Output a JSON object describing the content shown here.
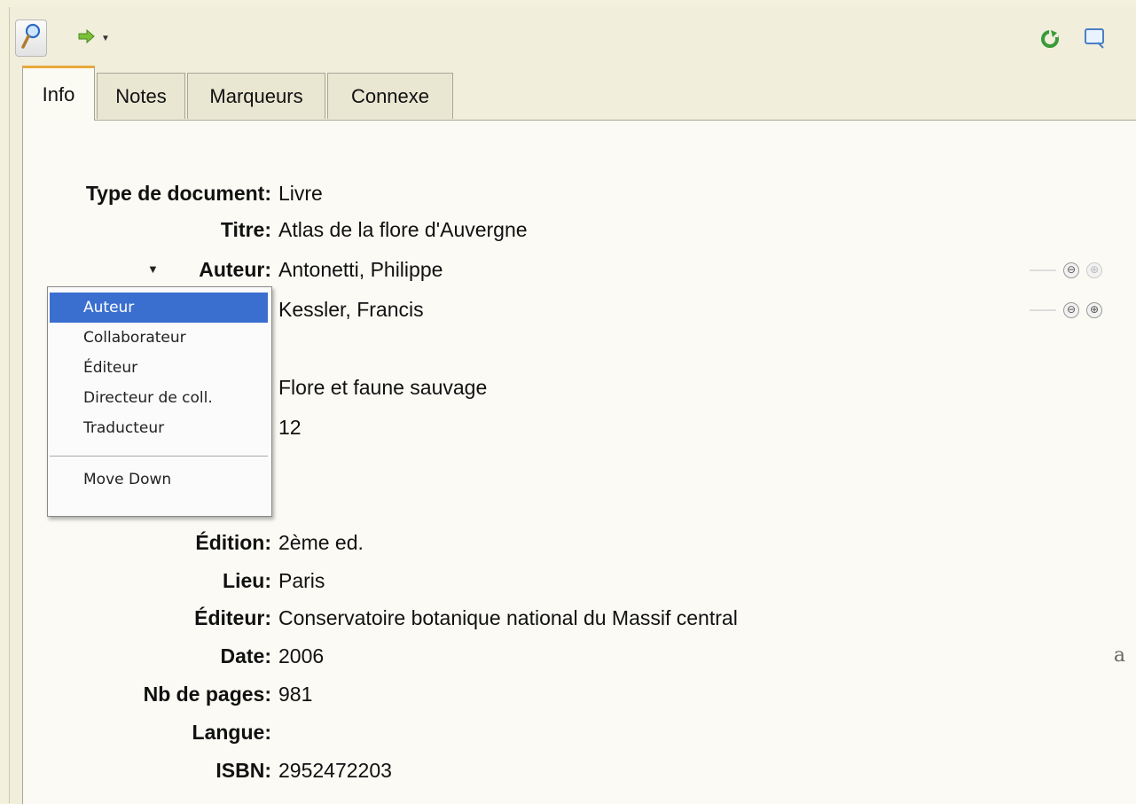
{
  "toolbar": {
    "search_icon": "magnifier-icon",
    "go_icon": "green-arrow-icon",
    "refresh_icon": "green-refresh-icon",
    "screen_icon": "screen-icon"
  },
  "tabs": [
    {
      "label": "Info",
      "active": true
    },
    {
      "label": "Notes",
      "active": false
    },
    {
      "label": "Marqueurs",
      "active": false
    },
    {
      "label": "Connexe",
      "active": false
    }
  ],
  "fields": {
    "type": {
      "label": "Type de document:",
      "value": "Livre"
    },
    "title": {
      "label": "Titre:",
      "value": "Atlas de la flore d'Auvergne"
    },
    "author1": {
      "label": "Auteur:",
      "value": "Antonetti, Philippe"
    },
    "author2": {
      "value": "Kessler, Francis"
    },
    "series": {
      "value": "Flore et faune sauvage"
    },
    "series_num": {
      "value": "12"
    },
    "edition": {
      "label": "Édition:",
      "value": "2ème ed."
    },
    "place": {
      "label": "Lieu:",
      "value": "Paris"
    },
    "publisher": {
      "label": "Éditeur:",
      "value": "Conservatoire botanique national du Massif central"
    },
    "date": {
      "label": "Date:",
      "value": "2006",
      "side": "a"
    },
    "pages": {
      "label": "Nb de pages:",
      "value": "981"
    },
    "language": {
      "label": "Langue:",
      "value": ""
    },
    "isbn": {
      "label": "ISBN:",
      "value": "2952472203"
    }
  },
  "row_buttons": {
    "minus": "⊖",
    "plus": "⊕"
  },
  "creator_menu": {
    "items": [
      "Auteur",
      "Collaborateur",
      "Éditeur",
      "Directeur de coll.",
      "Traducteur"
    ],
    "selected": "Auteur",
    "extra": "Move Down"
  },
  "colors": {
    "selection": "#3a6fd0",
    "tab_accent": "#e8a83a"
  }
}
